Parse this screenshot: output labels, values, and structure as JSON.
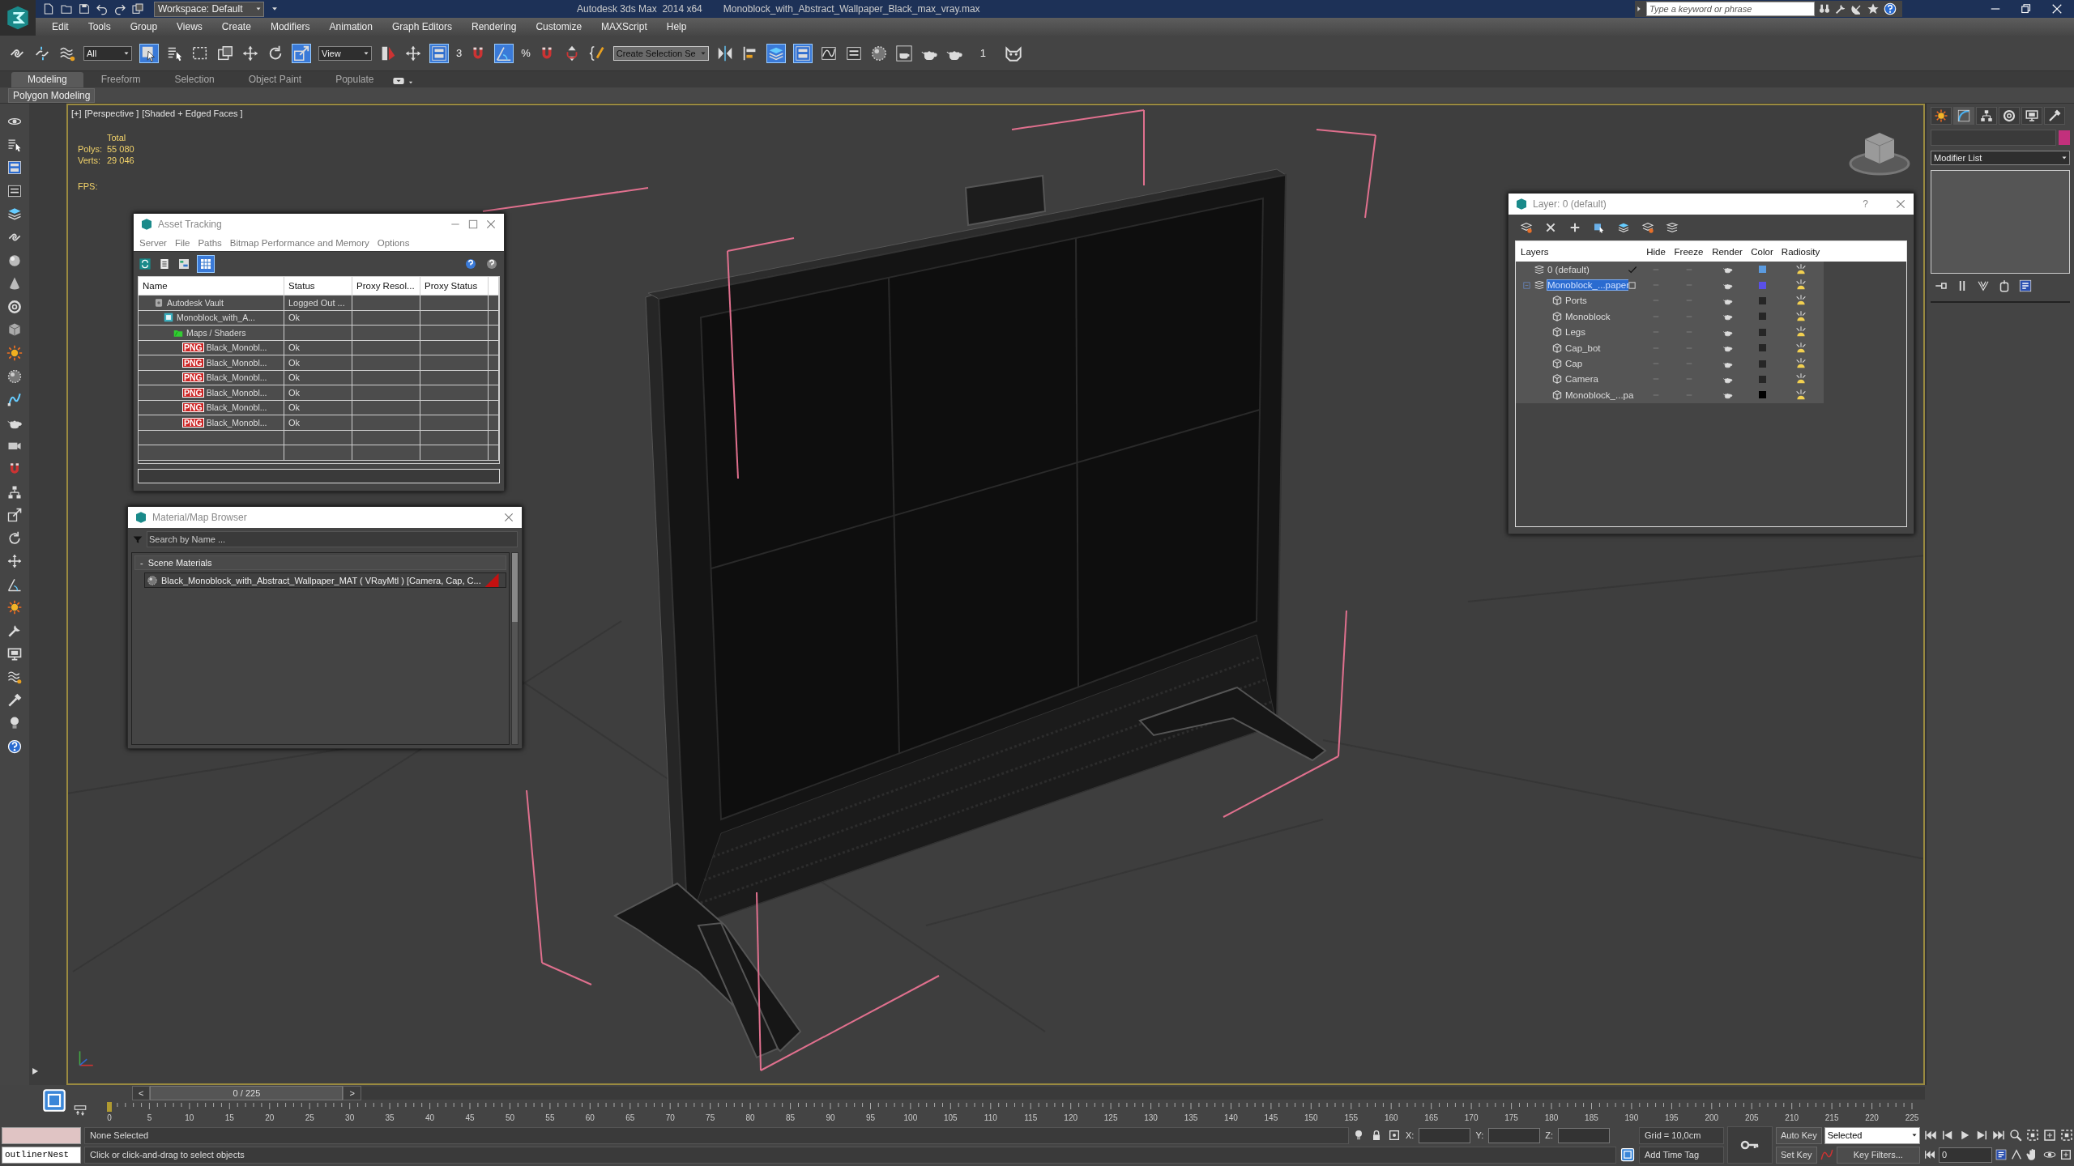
{
  "title_bar": {
    "workspace": "Workspace: Default",
    "app_title": "Autodesk 3ds Max  2014 x64",
    "file_title": "Monoblock_with_Abstract_Wallpaper_Black_max_vray.max",
    "search_placeholder": "Type a keyword or phrase"
  },
  "menu": [
    "Edit",
    "Tools",
    "Group",
    "Views",
    "Create",
    "Modifiers",
    "Animation",
    "Graph Editors",
    "Rendering",
    "Customize",
    "MAXScript",
    "Help"
  ],
  "toolbar": {
    "selection_filter": "All",
    "reference_coordinate": "View",
    "snap_dimension": "3",
    "percent_snap": "%",
    "named_selection": "Create Selection Se",
    "counter": "1"
  },
  "ribbon": {
    "tabs": [
      {
        "label": "Modeling",
        "selected": true
      },
      {
        "label": "Freeform",
        "selected": false
      },
      {
        "label": "Selection",
        "selected": false
      },
      {
        "label": "Object Paint",
        "selected": false
      },
      {
        "label": "Populate",
        "selected": false
      }
    ],
    "panel": "Polygon Modeling"
  },
  "viewport": {
    "labels": [
      "[+]",
      "[Perspective ]",
      "[Shaded + Edged Faces ]"
    ],
    "stats": {
      "header": "Total",
      "rows": [
        {
          "label": "Polys:",
          "value": "55 080"
        },
        {
          "label": "Verts:",
          "value": "29 046"
        }
      ],
      "fps_label": "FPS:"
    }
  },
  "asset_tracking": {
    "title": "Asset Tracking",
    "menu": [
      "Server",
      "File",
      "Paths",
      "Bitmap Performance and Memory",
      "Options"
    ],
    "columns": [
      "Name",
      "Status",
      "Proxy Resol...",
      "Proxy Status"
    ],
    "rows": [
      {
        "name": "Autodesk Vault",
        "status": "Logged Out ...",
        "kind": "vault",
        "selected": false,
        "children": [
          {
            "name": "Monoblock_with_A...",
            "status": "Ok",
            "kind": "scene",
            "selected": false,
            "children": [
              {
                "name": "Maps / Shaders",
                "kind": "folder",
                "selected": false,
                "children": [
                  {
                    "name": "Black_Monobl...",
                    "status": "Ok",
                    "kind": "png",
                    "icon_text": "PNG",
                    "selected": false
                  },
                  {
                    "name": "Black_Monobl...",
                    "status": "Ok",
                    "kind": "png",
                    "icon_text": "PNG",
                    "selected": false
                  },
                  {
                    "name": "Black_Monobl...",
                    "status": "Ok",
                    "kind": "png",
                    "icon_text": "PNG",
                    "selected": false
                  },
                  {
                    "name": "Black_Monobl...",
                    "status": "Ok",
                    "kind": "png",
                    "icon_text": "PNG",
                    "selected": false
                  },
                  {
                    "name": "Black_Monobl...",
                    "status": "Ok",
                    "kind": "png",
                    "icon_text": "PNG",
                    "selected": false
                  },
                  {
                    "name": "Black_Monobl...",
                    "status": "Ok",
                    "kind": "png",
                    "icon_text": "PNG",
                    "selected": false
                  }
                ]
              }
            ]
          }
        ]
      }
    ]
  },
  "material_browser": {
    "title": "Material/Map Browser",
    "search_placeholder": "Search by Name ...",
    "groups": [
      {
        "toggle": "-",
        "label": "Scene Materials",
        "expanded": true,
        "items": [
          "Black_Monoblock_with_Abstract_Wallpaper_MAT ( VRayMtl ) [Camera, Cap, C..."
        ]
      }
    ]
  },
  "layer_manager": {
    "title": "Layer: 0 (default)",
    "help": "?",
    "columns": [
      "Layers",
      "Hide",
      "Freeze",
      "Render",
      "Color",
      "Radiosity"
    ],
    "layers": [
      {
        "name": "0 (default)",
        "current": true,
        "selected": false,
        "color": "#5b9be0"
      },
      {
        "name": "Monoblock_...paper",
        "current": false,
        "selected": true,
        "expanded": true,
        "color": "#5a50e8",
        "children": [
          {
            "name": "Ports",
            "selected": false,
            "color": "#262626"
          },
          {
            "name": "Monoblock",
            "selected": false,
            "color": "#262626"
          },
          {
            "name": "Legs",
            "selected": false,
            "color": "#262626"
          },
          {
            "name": "Cap_bot",
            "selected": false,
            "color": "#262626"
          },
          {
            "name": "Cap",
            "selected": false,
            "color": "#262626"
          },
          {
            "name": "Camera",
            "selected": false,
            "color": "#262626"
          },
          {
            "name": "Monoblock_...pa",
            "selected": false,
            "color": "#000000"
          }
        ]
      }
    ]
  },
  "command_panel": {
    "modifier_list": "Modifier List"
  },
  "timeline": {
    "prev": "<",
    "position": "0 / 225",
    "next": ">",
    "frames": [
      "0",
      "5",
      "10",
      "15",
      "20",
      "25",
      "30",
      "35",
      "40",
      "45",
      "50",
      "55",
      "60",
      "65",
      "70",
      "75",
      "80",
      "85",
      "90",
      "95",
      "100",
      "105",
      "110",
      "115",
      "120",
      "125",
      "130",
      "135",
      "140",
      "145",
      "150",
      "155",
      "160",
      "165",
      "170",
      "175",
      "180",
      "185",
      "190",
      "195",
      "200",
      "205",
      "210",
      "215",
      "220",
      "225"
    ]
  },
  "status_bar": {
    "listener": "outlinerNest",
    "selection": "None Selected",
    "prompt": "Click or click-and-drag to select objects",
    "x_label": "X:",
    "y_label": "Y:",
    "z_label": "Z:",
    "grid": "Grid = 10,0cm",
    "time_tag": "Add Time Tag",
    "auto_key": "Auto Key",
    "key_mode": "Selected",
    "set_key": "Set Key",
    "key_filters": "Key Filters...",
    "current_frame": "0"
  }
}
